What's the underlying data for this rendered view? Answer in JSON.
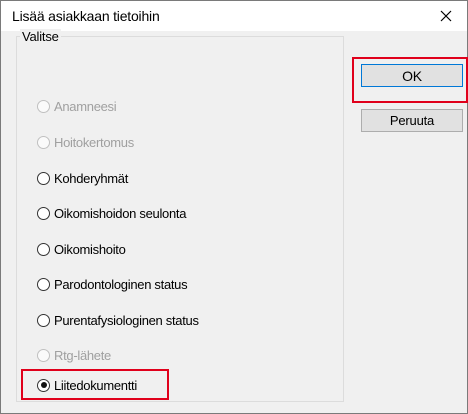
{
  "window": {
    "title": "Lisää asiakkaan tietoihin",
    "close_icon": "close-icon"
  },
  "group": {
    "label": "Valitse"
  },
  "options": [
    {
      "label": "Anamneesi",
      "enabled": false,
      "selected": false
    },
    {
      "label": "Hoitokertomus",
      "enabled": false,
      "selected": false
    },
    {
      "label": "Kohderyhmät",
      "enabled": true,
      "selected": false
    },
    {
      "label": "Oikomishoidon seulonta",
      "enabled": true,
      "selected": false
    },
    {
      "label": "Oikomishoito",
      "enabled": true,
      "selected": false
    },
    {
      "label": "Parodontologinen status",
      "enabled": true,
      "selected": false
    },
    {
      "label": "Purentafysiologinen status",
      "enabled": true,
      "selected": false
    },
    {
      "label": "Rtg-lähete",
      "enabled": false,
      "selected": false
    },
    {
      "label": "Liitedokumentti",
      "enabled": true,
      "selected": true
    }
  ],
  "buttons": {
    "ok_label": "OK",
    "cancel_label": "Peruuta"
  },
  "colors": {
    "highlight": "#e0001b",
    "dialog_bg": "#f0f0f0",
    "disabled_text": "#a0a0a0"
  }
}
